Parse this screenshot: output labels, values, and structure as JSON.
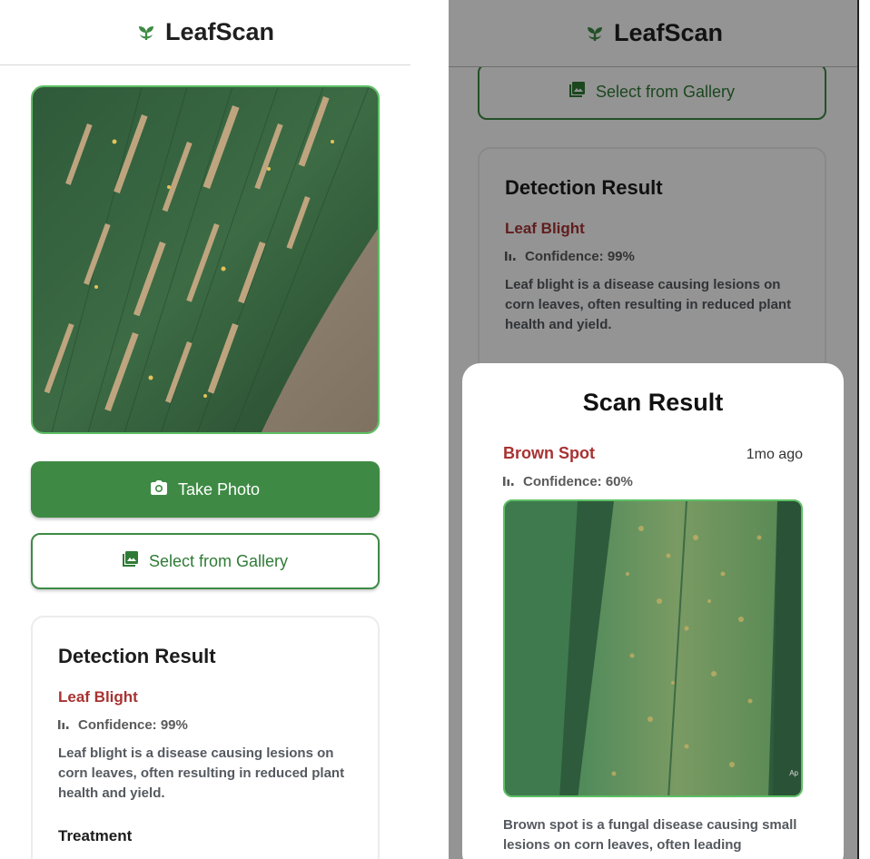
{
  "app": {
    "title": "LeafScan",
    "brand_color": "#3e8a44"
  },
  "left_screen": {
    "take_photo_label": "Take Photo",
    "gallery_label": "Select from Gallery",
    "result_card": {
      "title": "Detection Result",
      "disease": "Leaf Blight",
      "confidence_label": "Confidence: 99%",
      "description": "Leaf blight is a disease causing lesions on corn leaves, often resulting in reduced plant health and yield.",
      "treatment_heading": "Treatment"
    }
  },
  "right_screen": {
    "gallery_label": "Select from Gallery",
    "result_card": {
      "title": "Detection Result",
      "disease": "Leaf Blight",
      "confidence_label": "Confidence: 99%",
      "description": "Leaf blight is a disease causing lesions on corn leaves, often resulting in reduced plant health and yield."
    },
    "sheet": {
      "title": "Scan Result",
      "disease": "Brown Spot",
      "time_ago": "1mo ago",
      "confidence_label": "Confidence: 60%",
      "photo_watermark": "Ap",
      "description": "Brown spot is a fungal disease causing small lesions on corn leaves, often leading"
    }
  },
  "icons": {
    "logo": "sprout-icon",
    "camera": "camera-icon",
    "gallery": "image-icon",
    "confidence": "bar-chart-icon"
  }
}
